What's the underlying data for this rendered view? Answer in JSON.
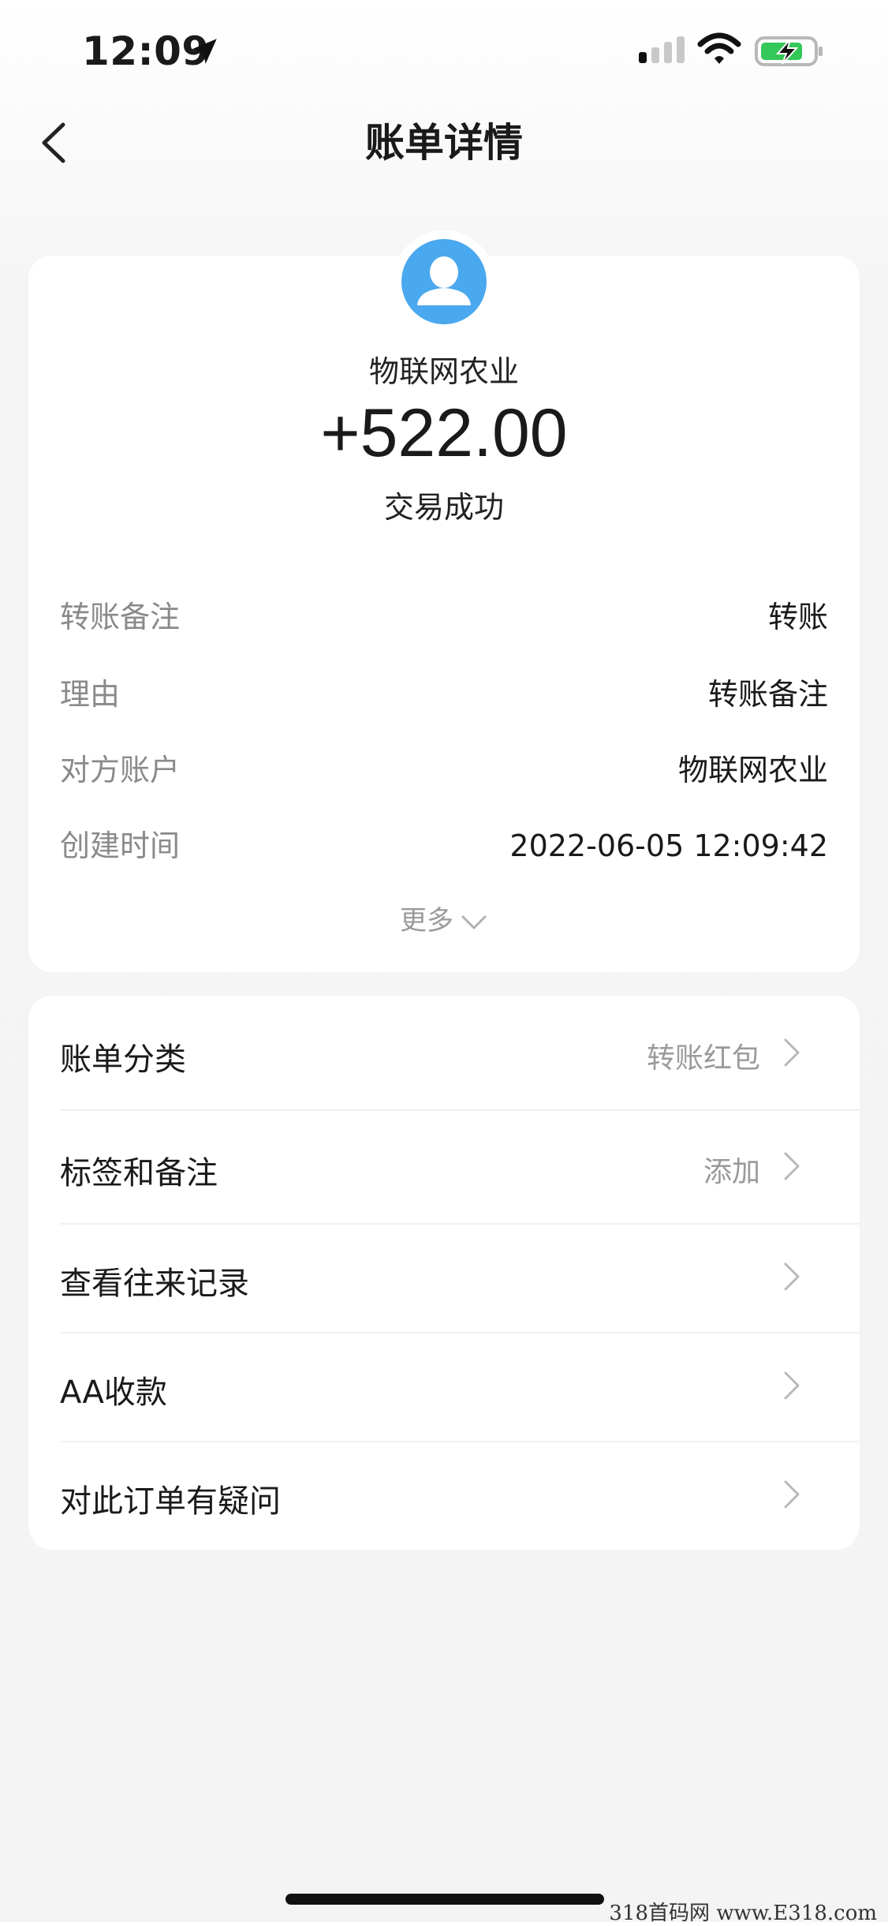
{
  "status_bar": {
    "time": "12:09"
  },
  "nav": {
    "title": "账单详情"
  },
  "transaction": {
    "counterparty": "物联网农业",
    "amount": "+522.00",
    "status": "交易成功"
  },
  "details": [
    {
      "label": "转账备注",
      "value": "转账"
    },
    {
      "label": "理由",
      "value": "转账备注"
    },
    {
      "label": "对方账户",
      "value": "物联网农业"
    },
    {
      "label": "创建时间",
      "value": "2022-06-05 12:09:42"
    }
  ],
  "more_label": "更多",
  "menu": [
    {
      "label": "账单分类",
      "value": "转账红包"
    },
    {
      "label": "标签和备注",
      "value": "添加"
    },
    {
      "label": "查看往来记录",
      "value": ""
    },
    {
      "label": "AA收款",
      "value": ""
    },
    {
      "label": "对此订单有疑问",
      "value": ""
    }
  ],
  "watermark": "318首码网 www.E318.com",
  "colors": {
    "avatar": "#4aa8ee",
    "background": "#f4f4f4",
    "card": "#ffffff",
    "battery": "#34c759"
  },
  "icons": [
    "location-arrow-icon",
    "signal-icon",
    "wifi-icon",
    "battery-charging-icon",
    "back-chevron-icon",
    "user-avatar-icon",
    "chevron-down-icon",
    "chevron-right-icon"
  ]
}
